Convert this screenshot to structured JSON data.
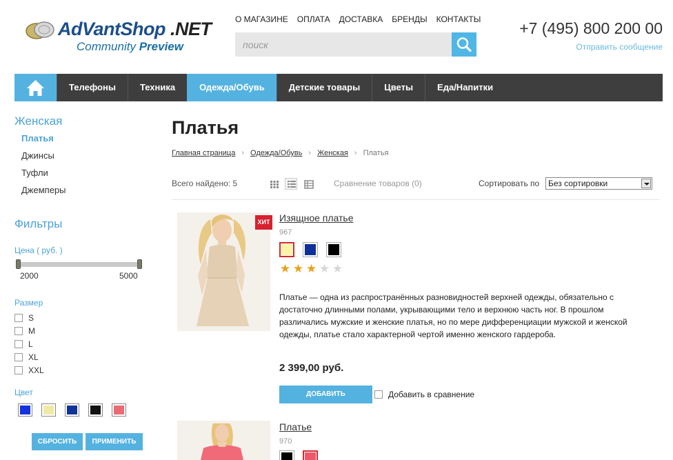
{
  "logo": {
    "brand": "AdVantShop",
    "brand_suffix": " .NET",
    "tag": "Community",
    "tag_bold": "Preview"
  },
  "topnav": [
    "О МАГАЗИНЕ",
    "ОПЛАТА",
    "ДОСТАВКА",
    "БРЕНДЫ",
    "КОНТАКТЫ"
  ],
  "search": {
    "placeholder": "поиск",
    "value": ""
  },
  "contact": {
    "phone": "+7 (495) 800 200 00",
    "send_message": "Отправить сообщение"
  },
  "menu": {
    "items": [
      "Телефоны",
      "Техника",
      "Одежда/Обувь",
      "Детские товары",
      "Цветы",
      "Еда/Напитки"
    ],
    "active": "Одежда/Обувь"
  },
  "sidebar": {
    "category_title": "Женская",
    "subcategories": [
      "Платья",
      "Джинсы",
      "Туфли",
      "Джемперы"
    ],
    "filters_title": "Фильтры",
    "price_label": "Цена ( руб. )",
    "price_min": "2000",
    "price_max": "5000",
    "price_range_fraction": [
      0.0,
      1.0
    ],
    "size_label": "Размер",
    "sizes": [
      "S",
      "M",
      "L",
      "XL",
      "XXL"
    ],
    "color_label": "Цвет",
    "colors": [
      "#1432e0",
      "#eeeaa6",
      "#10339a",
      "#111111",
      "#ec6a76"
    ],
    "reset_label": "СБРОСИТЬ",
    "apply_label": "ПРИМЕНИТЬ"
  },
  "content": {
    "title": "Платья",
    "breadcrumbs": [
      "Главная страница",
      "Одежда/Обувь",
      "Женская",
      "Платья"
    ],
    "found": "Всего найдено: 5",
    "compare": "Сравнение товаров (0)",
    "sort_label": "Сортировать по",
    "sort_value": "Без сортировки"
  },
  "products": [
    {
      "name": "Изящное платье",
      "sku": "967",
      "badge": "ХИТ",
      "colors": [
        "#f9f4a8",
        "#0f2f99",
        "#000000"
      ],
      "selected_color": 0,
      "rating": 3,
      "rating_max": 5,
      "description": "Платье — одна из распространённых разновидностей верхней одежды, обязательно с достаточно длинными полами, укрывающими тело и верхнюю часть ног. В прошлом различались мужские и женские платья, но по мере дифференциации мужской и женской одежды, платье стало характерной чертой именно женского гардероба.",
      "price": "2 399,00 руб.",
      "add_label": "ДОБАВИТЬ",
      "compare_label": "Добавить в сравнение"
    },
    {
      "name": "Платье",
      "sku": "970",
      "colors": [
        "#000000",
        "#f0576a"
      ],
      "selected_color": 1
    }
  ]
}
